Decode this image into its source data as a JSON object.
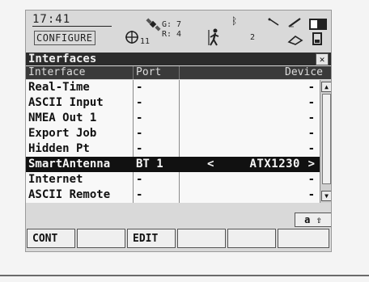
{
  "status": {
    "time": "17:41",
    "mode": "CONFIGURE",
    "sat_count": "11",
    "gps_count": "G: 7",
    "glonass_count": "R: 4",
    "bt_count": "2"
  },
  "window": {
    "title": "Interfaces",
    "close_label": "✕"
  },
  "table": {
    "headers": {
      "interface": "Interface",
      "port": "Port",
      "device": "Device"
    },
    "rows": [
      {
        "interface": "Real-Time",
        "port": "-",
        "device": "-"
      },
      {
        "interface": "ASCII Input",
        "port": "-",
        "device": "-"
      },
      {
        "interface": "NMEA Out 1",
        "port": "-",
        "device": "-"
      },
      {
        "interface": "Export Job",
        "port": "-",
        "device": "-"
      },
      {
        "interface": "Hidden Pt",
        "port": "-",
        "device": "-"
      },
      {
        "interface": "SmartAntenna",
        "port": "BT 1",
        "device": "ATX1230",
        "selected": true
      },
      {
        "interface": "Internet",
        "port": "-",
        "device": "-"
      },
      {
        "interface": "ASCII Remote",
        "port": "-",
        "device": "-"
      }
    ],
    "selector_left": "<",
    "selector_right": ">"
  },
  "input_mode": "a ⇧",
  "fkeys": {
    "f1": "CONT",
    "f2": "",
    "f3": "EDIT",
    "f4": "",
    "f5": "",
    "f6": ""
  },
  "colors": {
    "titlebar": "#2c2c2c",
    "selected_row": "#111111",
    "screen_bg": "#d9d9d9"
  }
}
